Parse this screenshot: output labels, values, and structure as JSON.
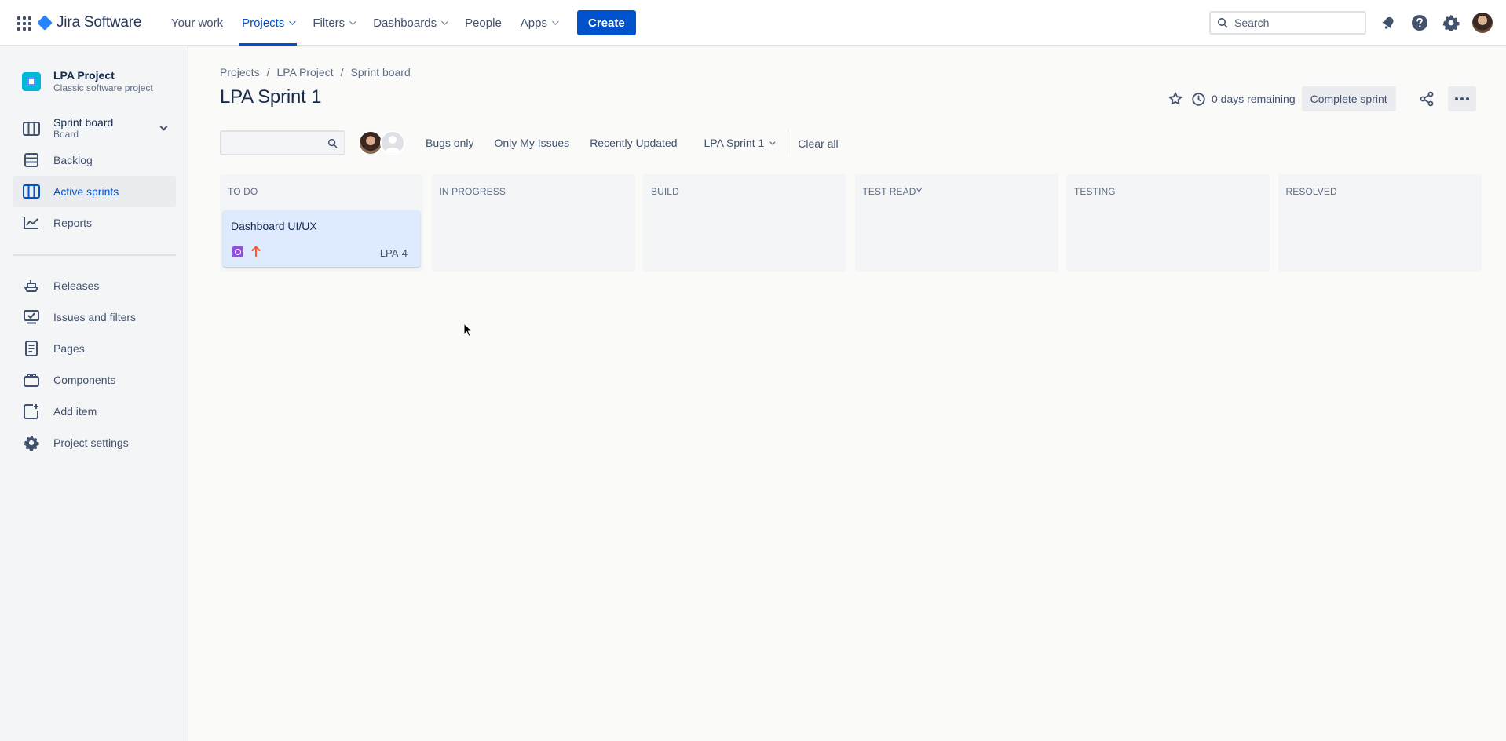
{
  "topnav": {
    "brand": "Jira Software",
    "items": [
      {
        "label": "Your work"
      },
      {
        "label": "Projects"
      },
      {
        "label": "Filters"
      },
      {
        "label": "Dashboards"
      },
      {
        "label": "People"
      },
      {
        "label": "Apps"
      }
    ],
    "active_item": "Projects",
    "create_label": "Create",
    "search_placeholder": "Search",
    "icons": [
      "notifications-icon",
      "help-icon",
      "settings-icon",
      "profile-avatar"
    ]
  },
  "sidebar": {
    "project_name": "LPA Project",
    "project_type": "Classic software project",
    "board_item": {
      "label": "Sprint board",
      "sub": "Board"
    },
    "planning_items": [
      {
        "label": "Backlog",
        "icon": "backlog-icon"
      },
      {
        "label": "Active sprints",
        "icon": "board-icon",
        "active": true
      },
      {
        "label": "Reports",
        "icon": "reports-icon"
      }
    ],
    "dev_items": [
      {
        "label": "Releases",
        "icon": "ship-icon"
      },
      {
        "label": "Issues and filters",
        "icon": "issues-icon"
      },
      {
        "label": "Pages",
        "icon": "page-icon"
      },
      {
        "label": "Components",
        "icon": "component-icon"
      },
      {
        "label": "Add item",
        "icon": "add-item-icon"
      },
      {
        "label": "Project settings",
        "icon": "gear-icon"
      }
    ]
  },
  "breadcrumb": [
    "Projects",
    "LPA Project",
    "Sprint board"
  ],
  "page_title": "LPA Sprint 1",
  "header": {
    "days_remaining": "0 days remaining",
    "complete_label": "Complete sprint"
  },
  "filters": {
    "quick_filters": [
      "Bugs only",
      "Only My Issues",
      "Recently Updated"
    ],
    "sprint_filter": "LPA Sprint 1",
    "clear_all": "Clear all"
  },
  "board": {
    "columns": [
      {
        "title": "TO DO",
        "cards": [
          {
            "title": "Dashboard UI/UX",
            "key": "LPA-4",
            "type": "epic",
            "priority": "high"
          }
        ]
      },
      {
        "title": "IN PROGRESS",
        "cards": []
      },
      {
        "title": "BUILD",
        "cards": []
      },
      {
        "title": "TEST READY",
        "cards": []
      },
      {
        "title": "TESTING",
        "cards": []
      },
      {
        "title": "RESOLVED",
        "cards": []
      }
    ]
  },
  "colors": {
    "primary": "#0052CC",
    "card_bg": "#DEEBFF",
    "epic": "#904EE2",
    "priority_high": "#FF5630"
  }
}
